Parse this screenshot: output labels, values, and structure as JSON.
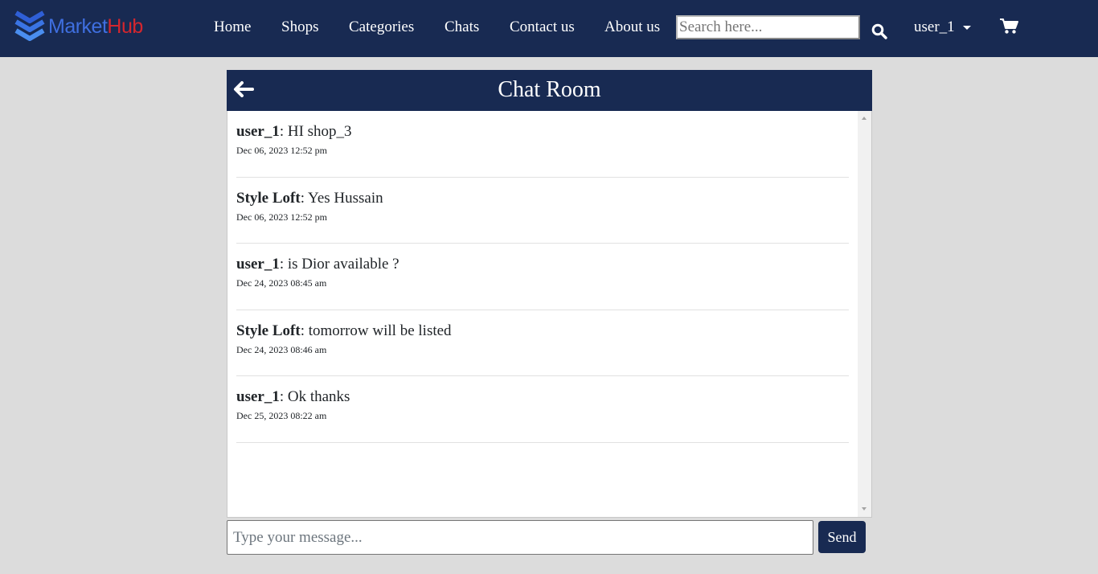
{
  "brand": {
    "part1": "Market",
    "part2": "Hub",
    "color1": "#3f6fe0",
    "color2": "#d4262e"
  },
  "nav": {
    "home": "Home",
    "shops": "Shops",
    "categories": "Categories",
    "chats": "Chats",
    "contact": "Contact us",
    "about": "About us"
  },
  "search": {
    "placeholder": "Search here...",
    "icon": "search-icon"
  },
  "user": {
    "name": "user_1",
    "icon": "caret-down-icon"
  },
  "cart": {
    "icon": "shopping-cart-icon"
  },
  "chat": {
    "title": "Chat Room",
    "back_icon": "arrow-left-icon",
    "messages": [
      {
        "sender": "user_1",
        "text": ": HI shop_3",
        "time": "Dec 06, 2023 12:52 pm"
      },
      {
        "sender": "Style Loft",
        "text": ": Yes Hussain",
        "time": "Dec 06, 2023 12:52 pm"
      },
      {
        "sender": "user_1",
        "text": ": is Dior available ?",
        "time": "Dec 24, 2023 08:45 am"
      },
      {
        "sender": "Style Loft",
        "text": ": tomorrow will be listed",
        "time": "Dec 24, 2023 08:46 am"
      },
      {
        "sender": "user_1",
        "text": ": Ok thanks",
        "time": "Dec 25, 2023 08:22 am"
      }
    ],
    "input_placeholder": "Type your message...",
    "send_label": "Send"
  },
  "colors": {
    "navbar": "#182a52",
    "background": "#dcdcdc"
  }
}
